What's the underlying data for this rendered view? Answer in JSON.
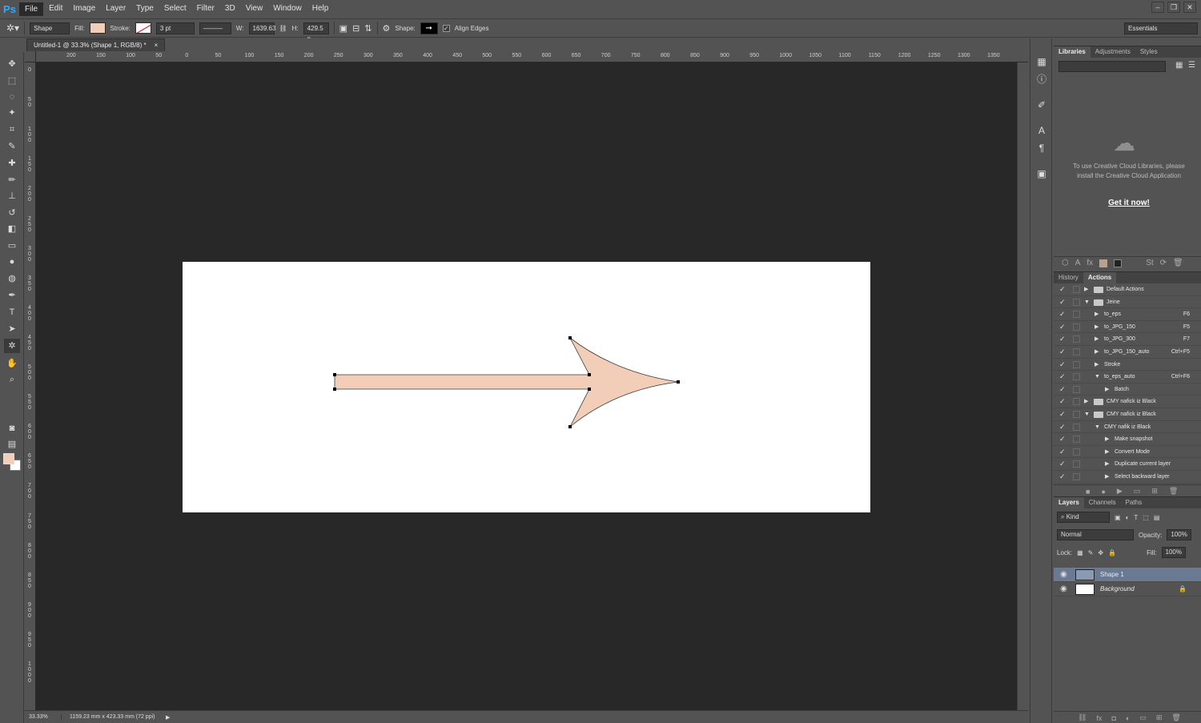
{
  "app": {
    "logo": "Ps"
  },
  "menu": [
    "File",
    "Edit",
    "Image",
    "Layer",
    "Type",
    "Select",
    "Filter",
    "3D",
    "View",
    "Window",
    "Help"
  ],
  "window_controls": [
    "–",
    "❐",
    "✕"
  ],
  "options": {
    "mode": "Shape",
    "fill_label": "Fill:",
    "stroke_label": "Stroke:",
    "stroke_width": "3 pt",
    "w_label": "W:",
    "w_value": "1639.63",
    "h_label": "H:",
    "h_value": "429.5 p",
    "shape_label": "Shape:",
    "align_edges": "Align Edges",
    "workspace": "Essentials",
    "fill_color": "#f2cdb7"
  },
  "document": {
    "tab_title": "Untitled-1 @ 33.3% (Shape 1, RGB/8) *",
    "tab_close": "×"
  },
  "rulers": {
    "top": [
      "200",
      "150",
      "100",
      "50",
      "0",
      "50",
      "100",
      "150",
      "200",
      "250",
      "300",
      "350",
      "400",
      "450",
      "500",
      "550",
      "600",
      "650",
      "700",
      "750",
      "800",
      "850",
      "900",
      "950",
      "1000",
      "1050",
      "1100",
      "1150",
      "1200",
      "1250",
      "1300",
      "1350"
    ],
    "left": [
      "0",
      "5\n0",
      "1\n0\n0",
      "1\n5\n0",
      "2\n0\n0",
      "2\n5\n0",
      "3\n0\n0",
      "3\n5\n0",
      "4\n0\n0",
      "4\n5\n0",
      "5\n0\n0",
      "5\n5\n0",
      "6\n0\n0",
      "6\n5\n0",
      "7\n0\n0",
      "7\n5\n0",
      "8\n0\n0",
      "8\n5\n0",
      "9\n0\n0",
      "9\n5\n0",
      "1\n0\n0\n0"
    ]
  },
  "status": {
    "zoom": "33.33%",
    "info": "1159.23 mm x 423.33 mm (72 ppi)"
  },
  "libraries": {
    "tabs": [
      "Libraries",
      "Adjustments",
      "Styles"
    ],
    "message": "To use Creative Cloud Libraries, please install the Creative Cloud Application",
    "link": "Get it now!"
  },
  "actions_panel": {
    "tabs": [
      "History",
      "Actions"
    ],
    "rows": [
      {
        "name": "Default Actions",
        "key": "",
        "level": 0,
        "folder": true,
        "open": false
      },
      {
        "name": "Jeine",
        "key": "",
        "level": 0,
        "folder": true,
        "open": true
      },
      {
        "name": "to_eps",
        "key": "F6",
        "level": 1,
        "folder": false,
        "open": false
      },
      {
        "name": "to_JPG_150",
        "key": "F5",
        "level": 1,
        "folder": false,
        "open": false
      },
      {
        "name": "to_JPG_300",
        "key": "F7",
        "level": 1,
        "folder": false,
        "open": false
      },
      {
        "name": "to_JPG_150_auto",
        "key": "Ctrl+F5",
        "level": 1,
        "folder": false,
        "open": false
      },
      {
        "name": "Stroke",
        "key": "",
        "level": 1,
        "folder": false,
        "open": false
      },
      {
        "name": "to_eps_auto",
        "key": "Ctrl+F6",
        "level": 1,
        "folder": false,
        "open": true
      },
      {
        "name": "Batch",
        "key": "",
        "level": 2,
        "folder": false,
        "open": false
      },
      {
        "name": "CMY nafick iz Black",
        "key": "",
        "level": 0,
        "folder": true,
        "open": false
      },
      {
        "name": "CMY nafick iz Black",
        "key": "",
        "level": 0,
        "folder": true,
        "open": true
      },
      {
        "name": "CMY nafik iz Black",
        "key": "",
        "level": 1,
        "folder": false,
        "open": true
      },
      {
        "name": "Make snapshot",
        "key": "",
        "level": 2,
        "folder": false,
        "open": false
      },
      {
        "name": "Convert Mode",
        "key": "",
        "level": 2,
        "folder": false,
        "open": false
      },
      {
        "name": "Duplicate current layer",
        "key": "",
        "level": 2,
        "folder": false,
        "open": false
      },
      {
        "name": "Select backward layer",
        "key": "",
        "level": 2,
        "folder": false,
        "open": false
      }
    ]
  },
  "layers_panel": {
    "tabs": [
      "Layers",
      "Channels",
      "Paths"
    ],
    "kind": "Kind",
    "blend_mode": "Normal",
    "opacity_label": "Opacity:",
    "opacity": "100%",
    "lock_label": "Lock:",
    "fill_label": "Fill:",
    "fill": "100%",
    "layers": [
      {
        "name": "Shape 1",
        "selected": true
      },
      {
        "name": "Background",
        "selected": false
      }
    ]
  }
}
